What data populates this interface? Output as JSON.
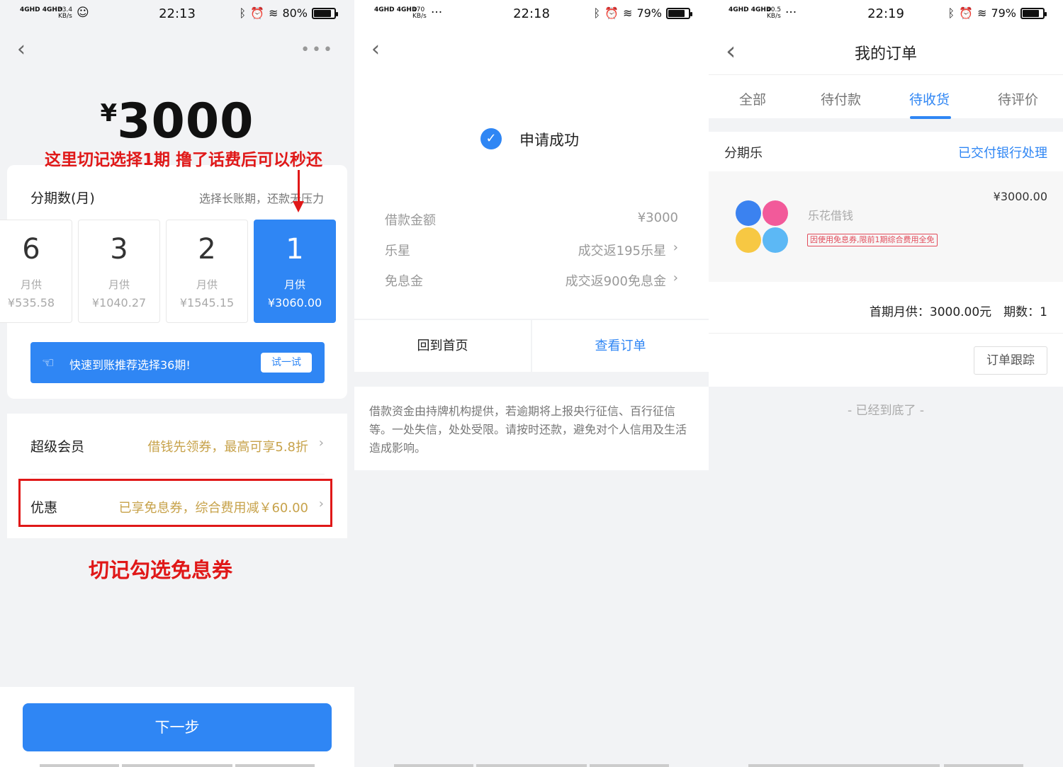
{
  "screen1": {
    "status": {
      "signal": "4GHD 4GHD",
      "speed_num": "33.4",
      "speed_unit": "KB/s",
      "extra": "☺",
      "time": "22:13",
      "battery": "80%",
      "battery_level": 0.8
    },
    "amount_yen": "¥",
    "amount": "3000",
    "annotation_top": "这里切记选择1期 撸了话费后可以秒还",
    "term_title": "分期数(月)",
    "term_hint": "选择长账期，还款无压力",
    "terms": [
      {
        "n": "6",
        "label": "月供",
        "amount": "¥535.58"
      },
      {
        "n": "3",
        "label": "月供",
        "amount": "¥1040.27"
      },
      {
        "n": "2",
        "label": "月供",
        "amount": "¥1545.15"
      },
      {
        "n": "1",
        "label": "月供",
        "amount": "¥3060.00"
      }
    ],
    "promo_text": "快速到账推荐选择36期!",
    "promo_button": "试一试",
    "vip_label": "超级会员",
    "vip_value": "借钱先领券，最高可享5.8折",
    "discount_label": "优惠",
    "discount_value": "已享免息券，综合费用减￥60.00",
    "annotation_bottom": "切记勾选免息券",
    "next_button": "下一步"
  },
  "screen2": {
    "status": {
      "signal": "4GHD 4GHD",
      "speed_num": "170",
      "speed_unit": "KB/s",
      "extra": "···",
      "time": "22:18",
      "battery": "79%",
      "battery_level": 0.79
    },
    "success": "申请成功",
    "rows": [
      {
        "label": "借款金额",
        "value": "¥3000"
      },
      {
        "label": "乐星",
        "value": "成交返195乐星"
      },
      {
        "label": "免息金",
        "value": "成交返900免息金"
      }
    ],
    "home_button": "回到首页",
    "order_button": "查看订单",
    "disclaimer": "借款资金由持牌机构提供，若逾期将上报央行征信、百行征信等。一处失信，处处受限。请按时还款，避免对个人信用及生活造成影响。"
  },
  "screen3": {
    "status": {
      "signal": "4GHD 4GHD",
      "speed_num": "40.5",
      "speed_unit": "KB/s",
      "extra": "···",
      "time": "22:19",
      "battery": "79%",
      "battery_level": 0.79
    },
    "title": "我的订单",
    "tabs": [
      "全部",
      "待付款",
      "待收货",
      "待评价"
    ],
    "active_tab": "待收货",
    "shop": "分期乐",
    "order_status": "已交付银行处理",
    "product_name": "乐花借钱",
    "product_tag": "因使用免息券,限前1期综合费用全免",
    "product_price": "¥3000.00",
    "summary": "首期月供：3000.00元　期数：1",
    "track_button": "订单跟踪",
    "end_text": "- 已经到底了 -"
  },
  "colors": {
    "accent": "#2f86f4",
    "annotation_red": "#e01818",
    "gold": "#c7a24a"
  }
}
